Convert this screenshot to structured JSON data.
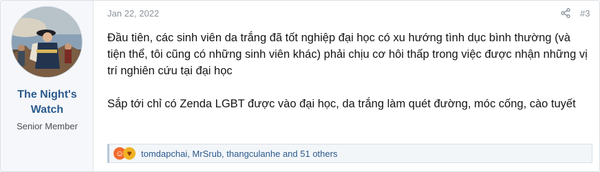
{
  "user": {
    "name": "The Night's Watch",
    "title": "Senior Member"
  },
  "post": {
    "date": "Jan 22, 2022",
    "number": "#3",
    "paragraphs": [
      "Đầu tiên, các sinh viên da trắng đã tốt nghiệp đại học có xu hướng tình dục bình thường (và tiện thể, tôi cũng có những sinh viên khác) phải chịu cơ hôi thấp trong việc được nhận những vị trí nghiên cứu tại đại học",
      "Sắp tới chỉ có Zenda LGBT được vào đại học, da trắng làm quét đường, móc cống, cào tuyết"
    ]
  },
  "reactions": {
    "icons": [
      "haha-icon",
      "love-icon"
    ],
    "users_text": "tomdapchai, MrSrub, thangculanhe and 51 others"
  },
  "colors": {
    "username": "#2b5a8c",
    "meta": "#8a929b",
    "reaction_bar": "#f3f6f9"
  }
}
